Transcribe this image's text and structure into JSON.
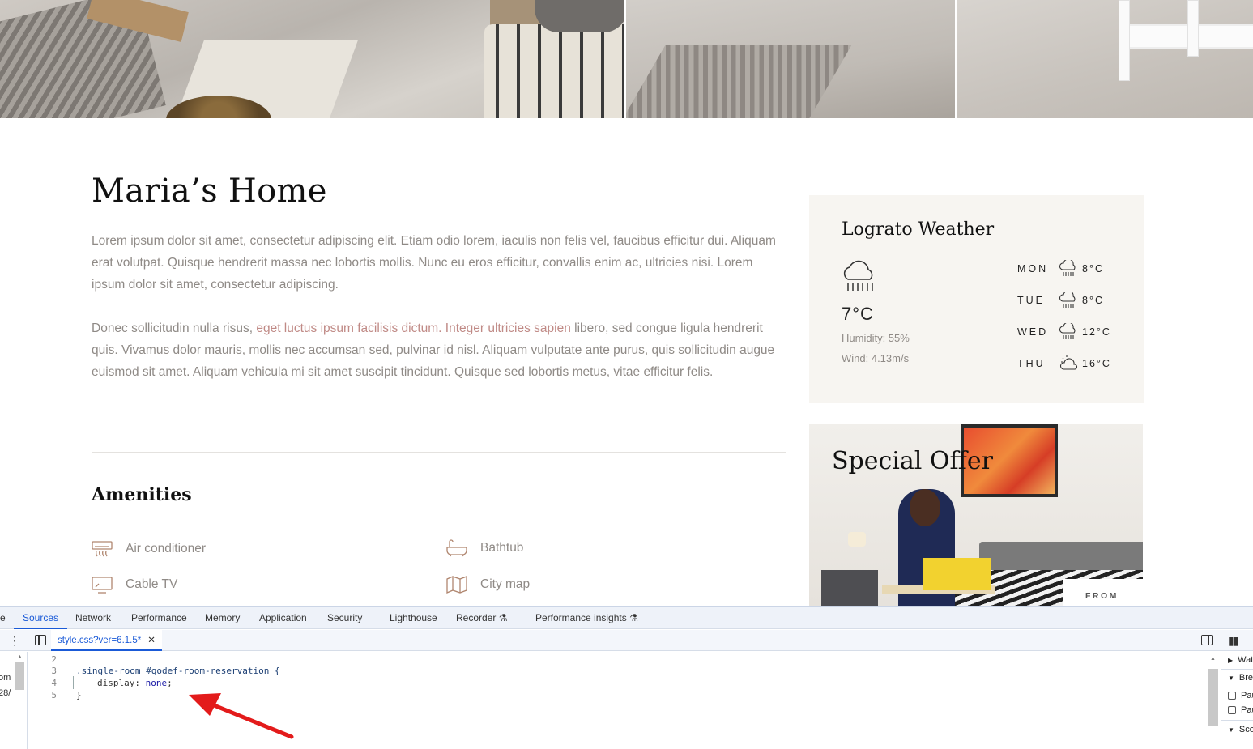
{
  "page": {
    "title": "Maria’s Home",
    "paragraph1": "Lorem ipsum dolor sit amet, consectetur adipiscing elit. Etiam odio lorem, iaculis non felis vel, faucibus efficitur dui. Aliquam erat volutpat. Quisque hendrerit massa nec lobortis mollis. Nunc eu eros efficitur, convallis enim ac, ultricies nisi. Lorem ipsum dolor sit amet, consectetur adipiscing.",
    "paragraph2_start": "Donec sollicitudin nulla risus, ",
    "paragraph2_highlight": "eget luctus ipsum facilisis dictum. Integer ultricies sapien",
    "paragraph2_end": " libero, sed congue ligula hendrerit quis. Vivamus dolor mauris, mollis nec accumsan sed, pulvinar id nisl. Aliquam vulputate ante purus, quis sollicitudin augue euismod sit amet. Aliquam vehicula mi sit amet suscipit tincidunt. Quisque sed lobortis metus, vitae efficitur felis.",
    "amenities_title": "Amenities",
    "amenities": [
      {
        "label": "Air conditioner",
        "icon": "air-conditioner-icon"
      },
      {
        "label": "Bathtub",
        "icon": "bathtub-icon"
      },
      {
        "label": "Cable TV",
        "icon": "tv-icon"
      },
      {
        "label": "City map",
        "icon": "map-icon"
      }
    ]
  },
  "weather": {
    "title": "Lograto Weather",
    "current_icon": "rain-cloud-icon",
    "temperature": "7°C",
    "humidity": "Humidity: 55%",
    "wind": "Wind: 4.13m/s",
    "forecast": [
      {
        "day": "MON",
        "icon": "rain-cloud-icon",
        "temp": "8°C"
      },
      {
        "day": "TUE",
        "icon": "rain-cloud-icon",
        "temp": "8°C"
      },
      {
        "day": "WED",
        "icon": "rain-cloud-icon",
        "temp": "12°C"
      },
      {
        "day": "THU",
        "icon": "partly-cloudy-icon",
        "temp": "16°C"
      }
    ]
  },
  "offer": {
    "title": "Special Offer",
    "from_label": "FROM"
  },
  "devtools": {
    "tabs": [
      "e",
      "Sources",
      "Network",
      "Performance",
      "Memory",
      "Application",
      "Security",
      "Lighthouse",
      "Recorder",
      "Performance insights"
    ],
    "active_tab": "Sources",
    "file_tab": "style.css?ver=6.1.5*",
    "left_nav_lines": [
      "om",
      "28/"
    ],
    "code_lines": [
      {
        "n": "2",
        "text": ""
      },
      {
        "n": "3",
        "text": ".single-room #qodef-room-reservation {"
      },
      {
        "n": "4",
        "prop": "display",
        "value": "none"
      },
      {
        "n": "5",
        "text": "}"
      }
    ],
    "right_pane": [
      "Wat",
      "Brea",
      "Pau",
      "Pau",
      "Sco"
    ]
  },
  "colors": {
    "accent_link": "#c08a86",
    "devtools_blue": "#1a5ad7",
    "annotation_arrow": "#e31b1b",
    "weather_bg": "#f7f5f1"
  }
}
